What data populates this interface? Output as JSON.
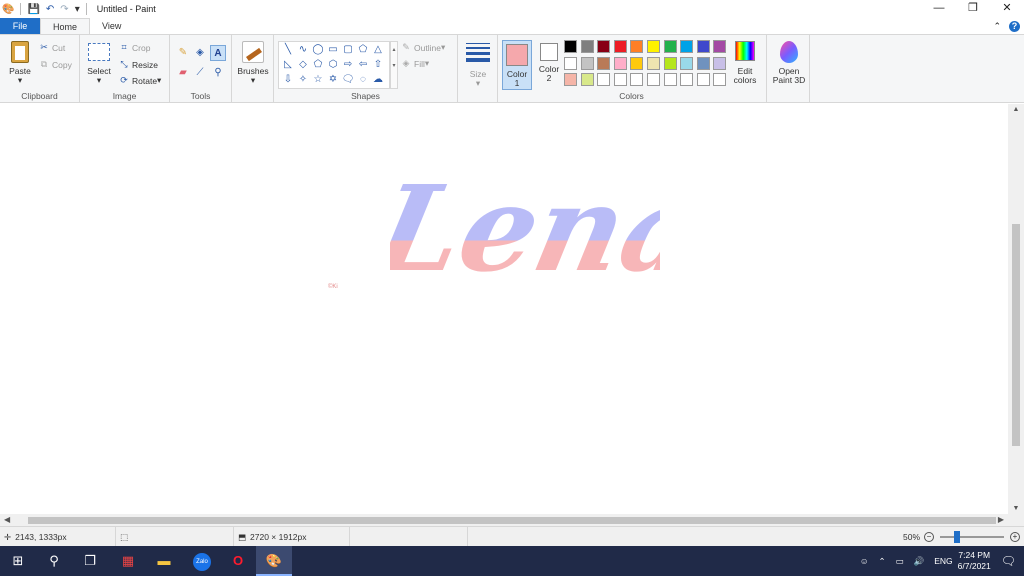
{
  "window": {
    "title": "Untitled - Paint",
    "controls": {
      "minimize": "—",
      "restore": "❐",
      "close": "✕"
    }
  },
  "quick_access": [
    "save-icon",
    "undo-icon",
    "redo-icon",
    "customize-icon"
  ],
  "tabs": {
    "file": "File",
    "home": "Home",
    "view": "View"
  },
  "ribbon": {
    "clipboard": {
      "label": "Clipboard",
      "paste": "Paste",
      "cut": "Cut",
      "copy": "Copy"
    },
    "image": {
      "label": "Image",
      "select": "Select",
      "crop": "Crop",
      "resize": "Resize",
      "rotate": "Rotate"
    },
    "tools": {
      "label": "Tools"
    },
    "brushes": {
      "label": "Brushes"
    },
    "shapes": {
      "label": "Shapes",
      "outline": "Outline",
      "fill": "Fill"
    },
    "size": {
      "label": "Size"
    },
    "colors": {
      "label": "Colors",
      "color1": "Color\n1",
      "color1_label": "Color",
      "color1_num": "1",
      "color2_label": "Color",
      "color2_num": "2",
      "color1_value": "#f5a8ac",
      "color2_value": "#ffffff",
      "edit": "Edit",
      "edit2": "colors",
      "paint3d": "Open",
      "paint3d2": "Paint 3D",
      "palette_row1": [
        "#000000",
        "#7f7f7f",
        "#880015",
        "#ed1c24",
        "#ff7f27",
        "#fff200",
        "#22b14c",
        "#00a2e8",
        "#3f48cc",
        "#a349a4"
      ],
      "palette_row2": [
        "#ffffff",
        "#c3c3c3",
        "#b97a57",
        "#ffaec9",
        "#ffc90e",
        "#efe4b0",
        "#b5e61d",
        "#99d9ea",
        "#7092be",
        "#c8bfe7"
      ],
      "palette_row3": [
        "#f5b5a8",
        "#d8e88a",
        "#ffffff",
        "#ffffff",
        "#ffffff",
        "#ffffff",
        "#ffffff",
        "#ffffff",
        "#ffffff",
        "#ffffff"
      ]
    }
  },
  "canvas": {
    "artwork_text": "Lena",
    "watermark": "©Ki",
    "top_color": "#b9bcf7",
    "bottom_color": "#f7b6b8"
  },
  "status": {
    "cursor_pos": "2143, 1333px",
    "image_size": "2720 × 1912px",
    "zoom": "50%"
  },
  "taskbar": {
    "apps": [
      "start-icon",
      "search-icon",
      "task-view-icon",
      "app-icon",
      "file-explorer-icon",
      "zalo-icon",
      "opera-icon",
      "paint-icon"
    ],
    "tray_lang": "ENG",
    "time": "7:24 PM",
    "date": "6/7/2021"
  }
}
